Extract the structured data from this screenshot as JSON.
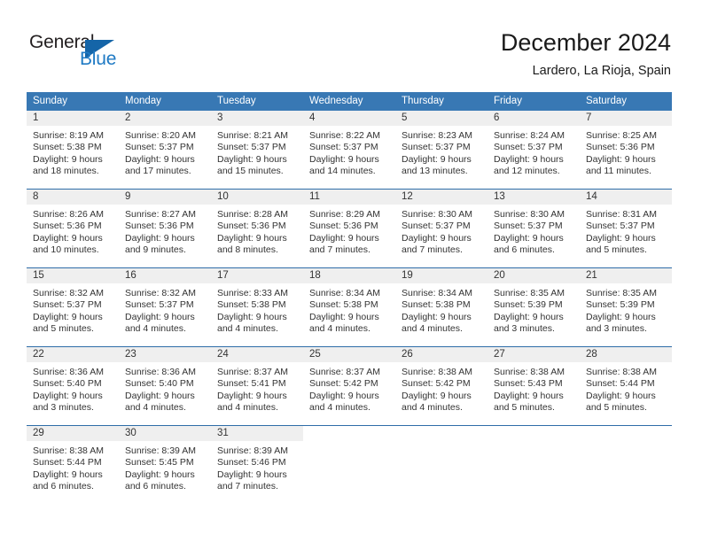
{
  "brand": {
    "word_one": "General",
    "word_two": "Blue",
    "triangle_icon": "triangle-icon"
  },
  "header": {
    "title": "December 2024",
    "subtitle": "Lardero, La Rioja, Spain"
  },
  "colors": {
    "header_blue": "#3878b4",
    "separator_blue": "#2e6da8",
    "daynum_band": "#efefef",
    "brand_blue": "#1f7ac4",
    "text": "#333333"
  },
  "weekday_headers": [
    "Sunday",
    "Monday",
    "Tuesday",
    "Wednesday",
    "Thursday",
    "Friday",
    "Saturday"
  ],
  "weeks": [
    [
      {
        "day": "1",
        "sunrise": "Sunrise: 8:19 AM",
        "sunset": "Sunset: 5:38 PM",
        "daylight_1": "Daylight: 9 hours",
        "daylight_2": "and 18 minutes."
      },
      {
        "day": "2",
        "sunrise": "Sunrise: 8:20 AM",
        "sunset": "Sunset: 5:37 PM",
        "daylight_1": "Daylight: 9 hours",
        "daylight_2": "and 17 minutes."
      },
      {
        "day": "3",
        "sunrise": "Sunrise: 8:21 AM",
        "sunset": "Sunset: 5:37 PM",
        "daylight_1": "Daylight: 9 hours",
        "daylight_2": "and 15 minutes."
      },
      {
        "day": "4",
        "sunrise": "Sunrise: 8:22 AM",
        "sunset": "Sunset: 5:37 PM",
        "daylight_1": "Daylight: 9 hours",
        "daylight_2": "and 14 minutes."
      },
      {
        "day": "5",
        "sunrise": "Sunrise: 8:23 AM",
        "sunset": "Sunset: 5:37 PM",
        "daylight_1": "Daylight: 9 hours",
        "daylight_2": "and 13 minutes."
      },
      {
        "day": "6",
        "sunrise": "Sunrise: 8:24 AM",
        "sunset": "Sunset: 5:37 PM",
        "daylight_1": "Daylight: 9 hours",
        "daylight_2": "and 12 minutes."
      },
      {
        "day": "7",
        "sunrise": "Sunrise: 8:25 AM",
        "sunset": "Sunset: 5:36 PM",
        "daylight_1": "Daylight: 9 hours",
        "daylight_2": "and 11 minutes."
      }
    ],
    [
      {
        "day": "8",
        "sunrise": "Sunrise: 8:26 AM",
        "sunset": "Sunset: 5:36 PM",
        "daylight_1": "Daylight: 9 hours",
        "daylight_2": "and 10 minutes."
      },
      {
        "day": "9",
        "sunrise": "Sunrise: 8:27 AM",
        "sunset": "Sunset: 5:36 PM",
        "daylight_1": "Daylight: 9 hours",
        "daylight_2": "and 9 minutes."
      },
      {
        "day": "10",
        "sunrise": "Sunrise: 8:28 AM",
        "sunset": "Sunset: 5:36 PM",
        "daylight_1": "Daylight: 9 hours",
        "daylight_2": "and 8 minutes."
      },
      {
        "day": "11",
        "sunrise": "Sunrise: 8:29 AM",
        "sunset": "Sunset: 5:36 PM",
        "daylight_1": "Daylight: 9 hours",
        "daylight_2": "and 7 minutes."
      },
      {
        "day": "12",
        "sunrise": "Sunrise: 8:30 AM",
        "sunset": "Sunset: 5:37 PM",
        "daylight_1": "Daylight: 9 hours",
        "daylight_2": "and 7 minutes."
      },
      {
        "day": "13",
        "sunrise": "Sunrise: 8:30 AM",
        "sunset": "Sunset: 5:37 PM",
        "daylight_1": "Daylight: 9 hours",
        "daylight_2": "and 6 minutes."
      },
      {
        "day": "14",
        "sunrise": "Sunrise: 8:31 AM",
        "sunset": "Sunset: 5:37 PM",
        "daylight_1": "Daylight: 9 hours",
        "daylight_2": "and 5 minutes."
      }
    ],
    [
      {
        "day": "15",
        "sunrise": "Sunrise: 8:32 AM",
        "sunset": "Sunset: 5:37 PM",
        "daylight_1": "Daylight: 9 hours",
        "daylight_2": "and 5 minutes."
      },
      {
        "day": "16",
        "sunrise": "Sunrise: 8:32 AM",
        "sunset": "Sunset: 5:37 PM",
        "daylight_1": "Daylight: 9 hours",
        "daylight_2": "and 4 minutes."
      },
      {
        "day": "17",
        "sunrise": "Sunrise: 8:33 AM",
        "sunset": "Sunset: 5:38 PM",
        "daylight_1": "Daylight: 9 hours",
        "daylight_2": "and 4 minutes."
      },
      {
        "day": "18",
        "sunrise": "Sunrise: 8:34 AM",
        "sunset": "Sunset: 5:38 PM",
        "daylight_1": "Daylight: 9 hours",
        "daylight_2": "and 4 minutes."
      },
      {
        "day": "19",
        "sunrise": "Sunrise: 8:34 AM",
        "sunset": "Sunset: 5:38 PM",
        "daylight_1": "Daylight: 9 hours",
        "daylight_2": "and 4 minutes."
      },
      {
        "day": "20",
        "sunrise": "Sunrise: 8:35 AM",
        "sunset": "Sunset: 5:39 PM",
        "daylight_1": "Daylight: 9 hours",
        "daylight_2": "and 3 minutes."
      },
      {
        "day": "21",
        "sunrise": "Sunrise: 8:35 AM",
        "sunset": "Sunset: 5:39 PM",
        "daylight_1": "Daylight: 9 hours",
        "daylight_2": "and 3 minutes."
      }
    ],
    [
      {
        "day": "22",
        "sunrise": "Sunrise: 8:36 AM",
        "sunset": "Sunset: 5:40 PM",
        "daylight_1": "Daylight: 9 hours",
        "daylight_2": "and 3 minutes."
      },
      {
        "day": "23",
        "sunrise": "Sunrise: 8:36 AM",
        "sunset": "Sunset: 5:40 PM",
        "daylight_1": "Daylight: 9 hours",
        "daylight_2": "and 4 minutes."
      },
      {
        "day": "24",
        "sunrise": "Sunrise: 8:37 AM",
        "sunset": "Sunset: 5:41 PM",
        "daylight_1": "Daylight: 9 hours",
        "daylight_2": "and 4 minutes."
      },
      {
        "day": "25",
        "sunrise": "Sunrise: 8:37 AM",
        "sunset": "Sunset: 5:42 PM",
        "daylight_1": "Daylight: 9 hours",
        "daylight_2": "and 4 minutes."
      },
      {
        "day": "26",
        "sunrise": "Sunrise: 8:38 AM",
        "sunset": "Sunset: 5:42 PM",
        "daylight_1": "Daylight: 9 hours",
        "daylight_2": "and 4 minutes."
      },
      {
        "day": "27",
        "sunrise": "Sunrise: 8:38 AM",
        "sunset": "Sunset: 5:43 PM",
        "daylight_1": "Daylight: 9 hours",
        "daylight_2": "and 5 minutes."
      },
      {
        "day": "28",
        "sunrise": "Sunrise: 8:38 AM",
        "sunset": "Sunset: 5:44 PM",
        "daylight_1": "Daylight: 9 hours",
        "daylight_2": "and 5 minutes."
      }
    ],
    [
      {
        "day": "29",
        "sunrise": "Sunrise: 8:38 AM",
        "sunset": "Sunset: 5:44 PM",
        "daylight_1": "Daylight: 9 hours",
        "daylight_2": "and 6 minutes."
      },
      {
        "day": "30",
        "sunrise": "Sunrise: 8:39 AM",
        "sunset": "Sunset: 5:45 PM",
        "daylight_1": "Daylight: 9 hours",
        "daylight_2": "and 6 minutes."
      },
      {
        "day": "31",
        "sunrise": "Sunrise: 8:39 AM",
        "sunset": "Sunset: 5:46 PM",
        "daylight_1": "Daylight: 9 hours",
        "daylight_2": "and 7 minutes."
      },
      {
        "day": "",
        "sunrise": "",
        "sunset": "",
        "daylight_1": "",
        "daylight_2": ""
      },
      {
        "day": "",
        "sunrise": "",
        "sunset": "",
        "daylight_1": "",
        "daylight_2": ""
      },
      {
        "day": "",
        "sunrise": "",
        "sunset": "",
        "daylight_1": "",
        "daylight_2": ""
      },
      {
        "day": "",
        "sunrise": "",
        "sunset": "",
        "daylight_1": "",
        "daylight_2": ""
      }
    ]
  ]
}
